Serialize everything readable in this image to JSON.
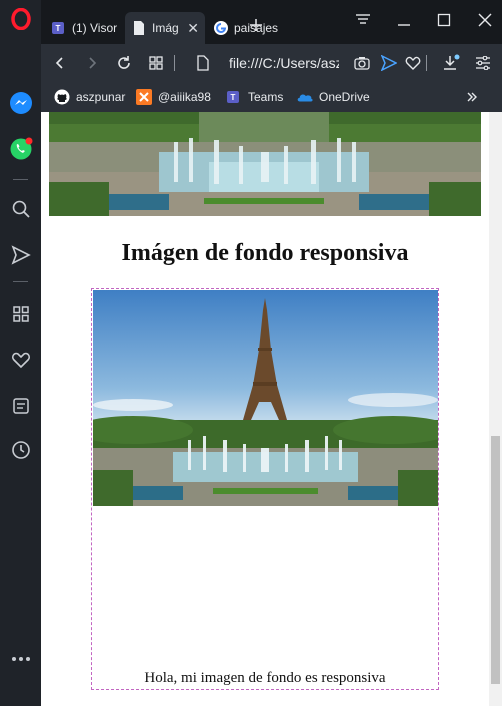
{
  "tabs": [
    {
      "label": "(1) Visor",
      "active": false,
      "icon": "teams-icon"
    },
    {
      "label": "Imág",
      "active": true,
      "icon": "page-icon"
    },
    {
      "label": "paisajes",
      "active": false,
      "icon": "google-icon"
    }
  ],
  "toolbar": {
    "address": "file:///C:/Users/aszpunar"
  },
  "bookmarks": [
    {
      "label": "aszpunar",
      "icon": "github-icon"
    },
    {
      "label": "@aiiika98",
      "icon": "xampp-icon"
    },
    {
      "label": "Teams",
      "icon": "teams-icon"
    },
    {
      "label": "OneDrive",
      "icon": "onedrive-icon"
    }
  ],
  "page": {
    "heading": "Imágen de fondo responsiva",
    "caption": "Hola, mi imagen de fondo es responsiva"
  },
  "colors": {
    "accent": "#ff1b2d",
    "box_border": "#c266c2"
  }
}
